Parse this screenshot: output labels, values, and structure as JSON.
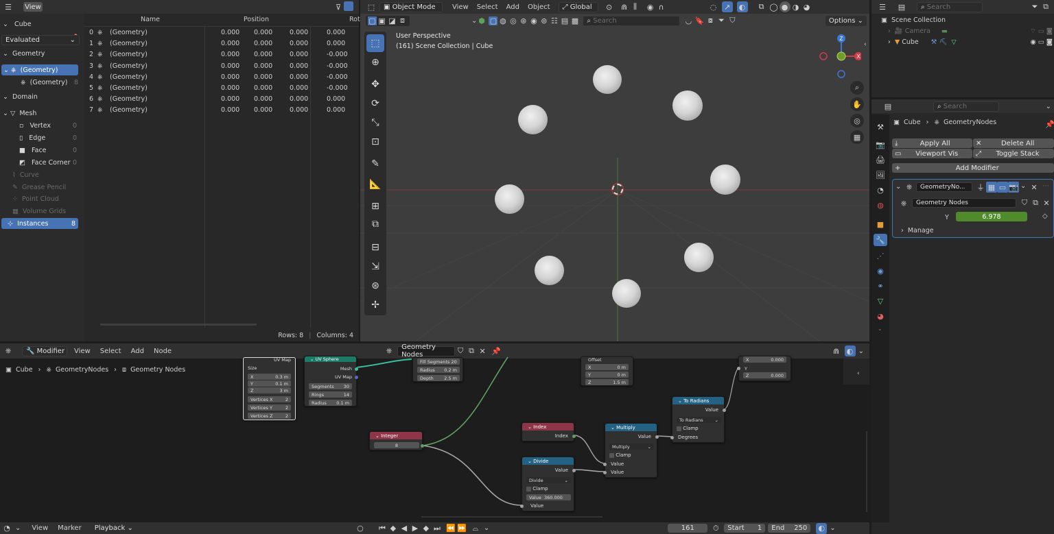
{
  "spreadsheet": {
    "header": {
      "view_menu": "View"
    },
    "object": "Cube",
    "eval_mode": "Evaluated",
    "geometry_label": "Geometry",
    "geometry_items": [
      {
        "label": "(Geometry)",
        "count": ""
      },
      {
        "label": "(Geometry)",
        "count": "8"
      }
    ],
    "domain_label": "Domain",
    "mesh_label": "Mesh",
    "mesh_items": [
      {
        "label": "Vertex",
        "count": "0"
      },
      {
        "label": "Edge",
        "count": "0"
      },
      {
        "label": "Face",
        "count": "0"
      },
      {
        "label": "Face Corner",
        "count": "0"
      }
    ],
    "other_domains": [
      "Curve",
      "Grease Pencil",
      "Point Cloud",
      "Volume Grids"
    ],
    "instances": {
      "label": "Instances",
      "count": "8"
    },
    "columns": [
      "Name",
      "Position",
      "Rot"
    ],
    "rows": [
      {
        "idx": "0",
        "name": "(Geometry)",
        "x": "0.000",
        "y": "0.000",
        "z": "0.000",
        "r": "0.000"
      },
      {
        "idx": "1",
        "name": "(Geometry)",
        "x": "0.000",
        "y": "0.000",
        "z": "0.000",
        "r": "0.000"
      },
      {
        "idx": "2",
        "name": "(Geometry)",
        "x": "0.000",
        "y": "0.000",
        "z": "0.000",
        "r": "-0.000"
      },
      {
        "idx": "3",
        "name": "(Geometry)",
        "x": "0.000",
        "y": "0.000",
        "z": "0.000",
        "r": "-0.000"
      },
      {
        "idx": "4",
        "name": "(Geometry)",
        "x": "0.000",
        "y": "0.000",
        "z": "0.000",
        "r": "-0.000"
      },
      {
        "idx": "5",
        "name": "(Geometry)",
        "x": "0.000",
        "y": "0.000",
        "z": "0.000",
        "r": "-0.000"
      },
      {
        "idx": "6",
        "name": "(Geometry)",
        "x": "0.000",
        "y": "0.000",
        "z": "0.000",
        "r": "0.000"
      },
      {
        "idx": "7",
        "name": "(Geometry)",
        "x": "0.000",
        "y": "0.000",
        "z": "0.000",
        "r": "0.000"
      }
    ],
    "footer": {
      "rows": "Rows: 8",
      "columns": "Columns: 4"
    }
  },
  "viewport": {
    "mode": "Object Mode",
    "menus": [
      "View",
      "Select",
      "Add",
      "Object"
    ],
    "orientation": "Global",
    "search_placeholder": "Search",
    "options": "Options",
    "overlay_title": "User Perspective",
    "overlay_sub": "(161) Scene Collection | Cube",
    "gizmo": {
      "z": "Z",
      "x": "X"
    }
  },
  "outliner": {
    "search_placeholder": "Search",
    "root": "Scene Collection",
    "items": [
      "Camera",
      "Cube"
    ]
  },
  "properties": {
    "search_placeholder": "Search",
    "breadcrumb": [
      "Cube",
      "GeometryNodes"
    ],
    "apply_all": "Apply All",
    "delete_all": "Delete All",
    "viewport_vis": "Viewport Vis",
    "toggle_stack": "Toggle Stack",
    "add_modifier": "Add Modifier",
    "modifier_name": "GeometryNo...",
    "node_group": "Geometry Nodes",
    "y_label": "Y",
    "y_value": "6.978",
    "manage": "Manage"
  },
  "node_editor": {
    "editor_type": "Modifier",
    "menus": [
      "View",
      "Select",
      "Add",
      "Node"
    ],
    "tree_name": "Geometry Nodes",
    "breadcrumb": [
      "Cube",
      "GeometryNodes",
      "Geometry Nodes"
    ],
    "cube_node": {
      "uv_map": "UV Map",
      "size": "Size",
      "x": "X",
      "x_val": "0.3 m",
      "y": "Y",
      "y_val": "0.1 m",
      "z": "Z",
      "z_val": "3 m",
      "vx": "Vertices X",
      "vx_val": "2",
      "vy": "Vertices Y",
      "vy_val": "2",
      "vz": "Vertices Z",
      "vz_val": "2"
    },
    "uvsphere_node": {
      "title": "UV Sphere",
      "mesh": "Mesh",
      "uv_map": "UV Map",
      "segments": "Segments",
      "segments_val": "30",
      "rings": "Rings",
      "rings_val": "14",
      "radius": "Radius",
      "radius_val": "0.1 m"
    },
    "cyl_node": {
      "fill": "Fill Segments",
      "fill_val": "20",
      "radius": "Radius",
      "radius_val": "0.2 m",
      "depth": "Depth",
      "depth_val": "2.5 m"
    },
    "offset_node": {
      "offset": "Offset",
      "x": "X",
      "x_val": "0 m",
      "y": "Y",
      "y_val": "0 m",
      "z": "Z",
      "z_val": "1.5 m"
    },
    "xyz_node": {
      "x": "X",
      "x_val": "0.000",
      "y": "Y",
      "z": "Z",
      "z_val": "0.000"
    },
    "integer_node": {
      "title": "Integer",
      "value": "8"
    },
    "index_node": {
      "title": "Index",
      "out": "Index"
    },
    "divide_node": {
      "title": "Divide",
      "out": "Value",
      "op": "Divide",
      "clamp": "Clamp",
      "value_label": "Value",
      "value_val": "360.000",
      "in": "Value"
    },
    "multiply_node": {
      "title": "Multiply",
      "out": "Value",
      "op": "Multiply",
      "clamp": "Clamp",
      "in1": "Value",
      "in2": "Value"
    },
    "radians_node": {
      "title": "To Radians",
      "out": "Value",
      "op": "To Radians",
      "clamp": "Clamp",
      "in": "Degrees"
    }
  },
  "timeline": {
    "menus": [
      "View",
      "Marker",
      "Playback"
    ],
    "frame": "161",
    "start_label": "Start",
    "start": "1",
    "end_label": "End",
    "end": "250"
  }
}
